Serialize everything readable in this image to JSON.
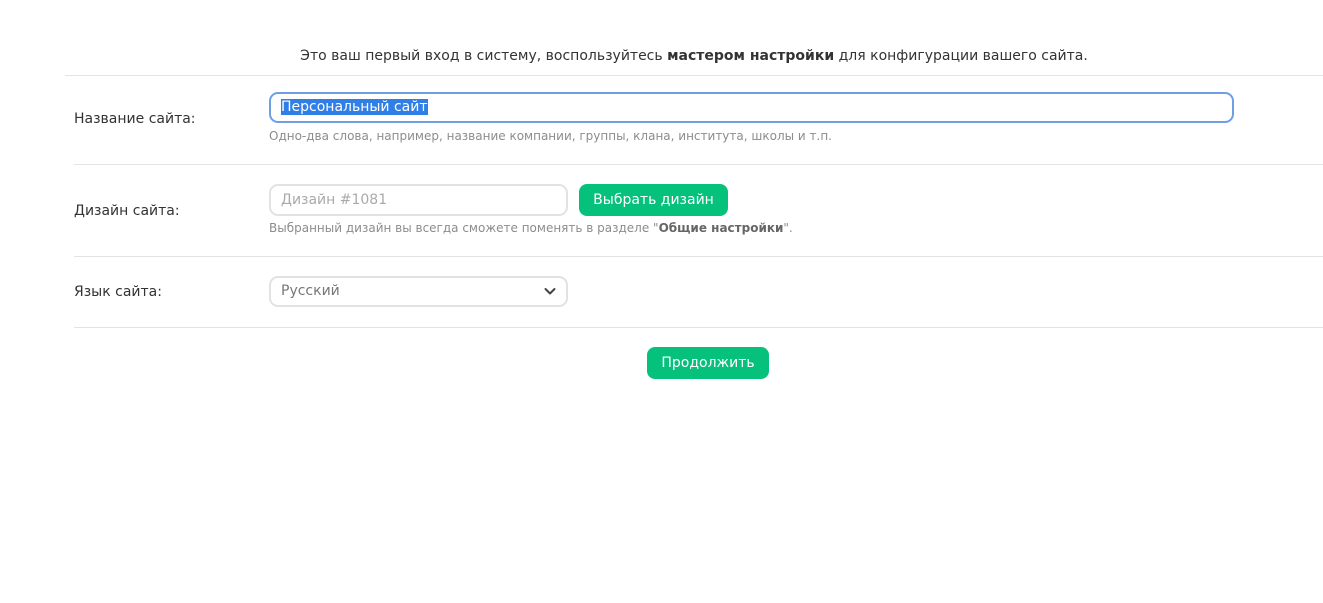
{
  "intro": {
    "text_before": "Это ваш первый вход в систему, воспользуйтесь ",
    "text_bold": "мастером настройки",
    "text_after": " для конфигурации вашего сайта."
  },
  "site_name": {
    "label": "Название сайта:",
    "value": "Персональный сайт",
    "hint": "Одно-два слова, например, название компании, группы, клана, института, школы и т.п."
  },
  "site_design": {
    "label": "Дизайн сайта:",
    "placeholder": "Дизайн #1081",
    "button_label": "Выбрать дизайн",
    "hint_before": "Выбранный дизайн вы всегда сможете поменять в разделе \"",
    "hint_bold": "Общие настройки",
    "hint_after": "\"."
  },
  "site_language": {
    "label": "Язык сайта:",
    "selected": "Русский",
    "icon": "chevron-down-icon"
  },
  "actions": {
    "continue_label": "Продолжить"
  },
  "colors": {
    "accent": "#06c17c",
    "focus_border": "#6f9fe0",
    "selection": "#2f7fe6"
  }
}
